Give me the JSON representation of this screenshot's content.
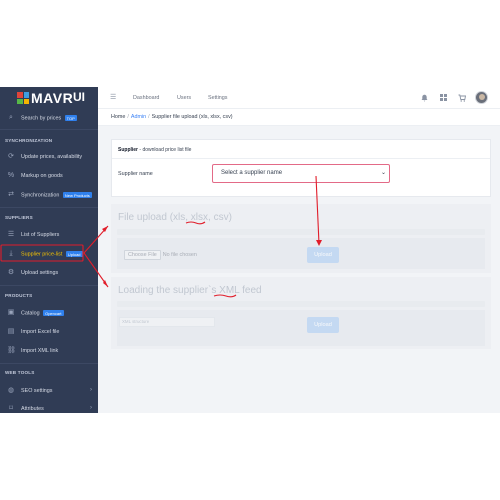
{
  "brand": {
    "name": "MAVR",
    "suffix": "UI",
    "logo_colors": [
      "#e0443a",
      "#3f9de0",
      "#57b848",
      "#f4b400"
    ]
  },
  "sidebar": {
    "search": {
      "label": "Search by prices",
      "badge": "TOP",
      "badge_color": "#2f80ed"
    },
    "sections": [
      {
        "title": "SYNCHRONIZATION",
        "items": [
          {
            "label": "Update prices, availability",
            "icon": "refresh-icon"
          },
          {
            "label": "Markup on goods",
            "icon": "percent-icon"
          },
          {
            "label": "Synchronization",
            "icon": "sync-icon",
            "badge": "New Products",
            "badge_color": "#2f80ed"
          }
        ]
      },
      {
        "title": "SUPPLIERS",
        "items": [
          {
            "label": "List of Suppliers",
            "icon": "list-icon"
          },
          {
            "label": "Supplier price-list",
            "icon": "download-icon",
            "badge": "Upload",
            "badge_color": "#2f80ed",
            "active": true
          },
          {
            "label": "Upload settings",
            "icon": "gear-icon"
          }
        ]
      },
      {
        "title": "PRODUCTS",
        "items": [
          {
            "label": "Catalog",
            "icon": "box-icon",
            "badge": "Opencart",
            "badge_color": "#2f80ed"
          },
          {
            "label": "Import Excel file",
            "icon": "file-icon"
          },
          {
            "label": "Import XML link",
            "icon": "link-icon"
          }
        ]
      },
      {
        "title": "WEB TOOLS",
        "items": [
          {
            "label": "SEO settings",
            "icon": "globe-icon",
            "chevron": "›"
          },
          {
            "label": "Attributes",
            "icon": "tag-icon",
            "chevron": "›"
          }
        ]
      }
    ]
  },
  "topbar": {
    "menu_icon": "☰",
    "links": [
      "Dashboard",
      "Users",
      "Settings"
    ]
  },
  "breadcrumb": {
    "items": [
      "Home",
      "Admin",
      "Supplier file upload (xls, xlsx, csv)"
    ],
    "separator": "/"
  },
  "main_card": {
    "title_bold": "Supplier",
    "title_rest": " - download price list file",
    "field_label": "Supplier name",
    "select_value": "Select a supplier name",
    "select_caret": "⌄"
  },
  "file_upload": {
    "title": "File upload (xls, xlsx, csv)",
    "choose_button": "Choose File",
    "no_file": "No file chosen",
    "upload_label": "Upload"
  },
  "xml_feed": {
    "title": "Loading the supplier`s XML feed",
    "input_placeholder": "XML structure",
    "upload_label": "Upload"
  },
  "annotation_color": "#e11d2a"
}
